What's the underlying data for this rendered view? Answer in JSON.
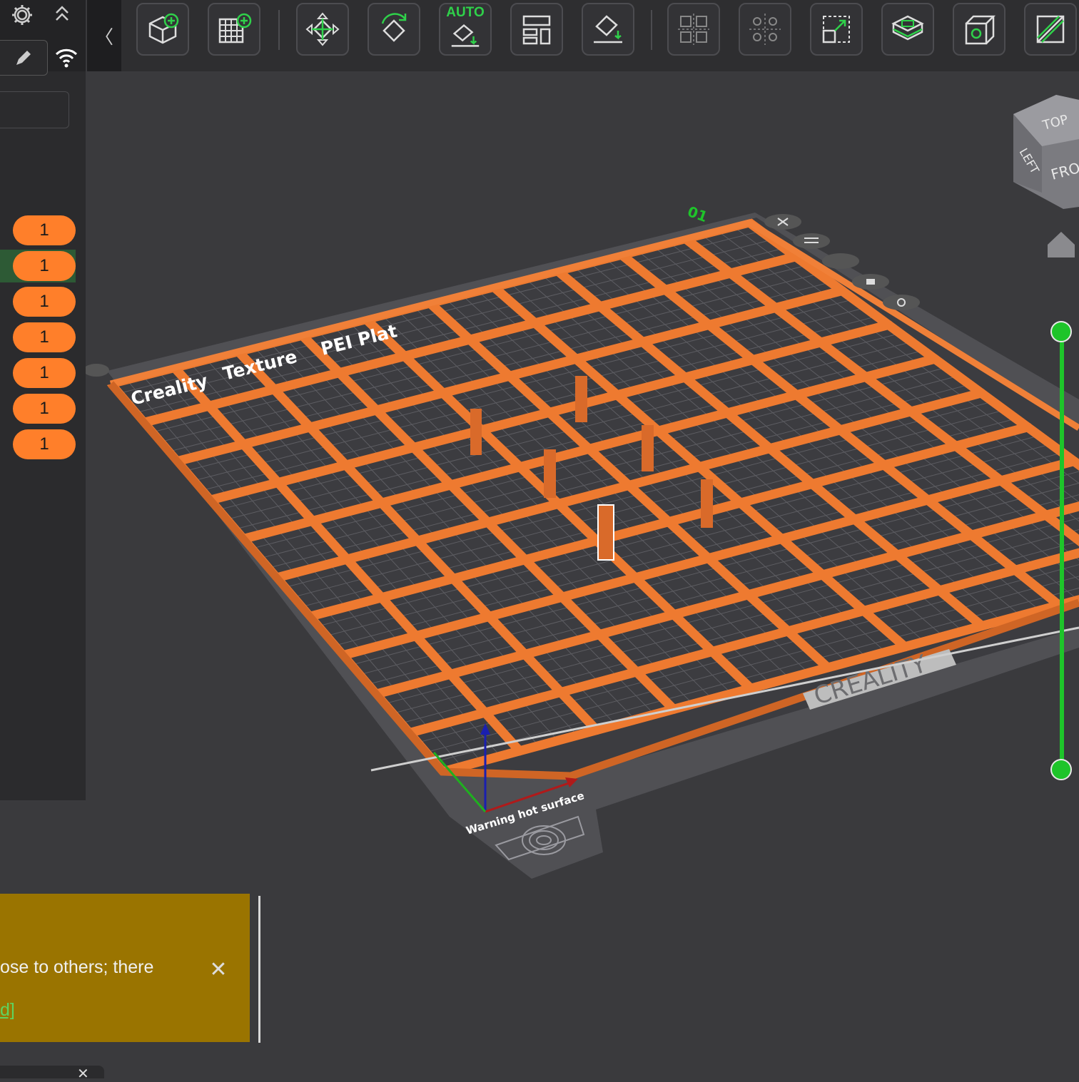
{
  "left_panel": {
    "wifi_icon": "wifi-icon",
    "search_placeholder": "",
    "plates": [
      {
        "count": "1",
        "selected": false
      },
      {
        "count": "1",
        "selected": true
      },
      {
        "count": "1",
        "selected": false
      },
      {
        "count": "1",
        "selected": false
      },
      {
        "count": "1",
        "selected": false
      },
      {
        "count": "1",
        "selected": false
      },
      {
        "count": "1",
        "selected": false
      }
    ]
  },
  "toolbar": {
    "collapse_glyph": "〈",
    "auto_label": "AUTO",
    "buttons": [
      "add-object-icon",
      "add-plate-icon",
      "auto-arrange-icon",
      "auto-orient-icon",
      "auto-lay-flat-icon",
      "arrange-layout-icon",
      "lay-on-face-icon",
      "split-objects-icon",
      "split-parts-icon",
      "fit-scale-icon",
      "support-paint-icon",
      "cut-icon",
      "seam-paint-icon"
    ]
  },
  "viewport": {
    "plate_number": "01",
    "bed_labels": {
      "texture_1": "Creality",
      "texture_2": "Texture",
      "texture_3": "PEI Plat",
      "brand": "CREALITY",
      "warning": "Warning hot surface"
    },
    "view_cube": {
      "top": "TOP",
      "left": "LEFT",
      "front": "FRO"
    },
    "accent_orange": "#f07a2e",
    "accent_green": "#1ec42a"
  },
  "notification": {
    "text": "ose to others; there",
    "link": "d]",
    "close_glyph": "✕",
    "background": "#9a7400"
  }
}
